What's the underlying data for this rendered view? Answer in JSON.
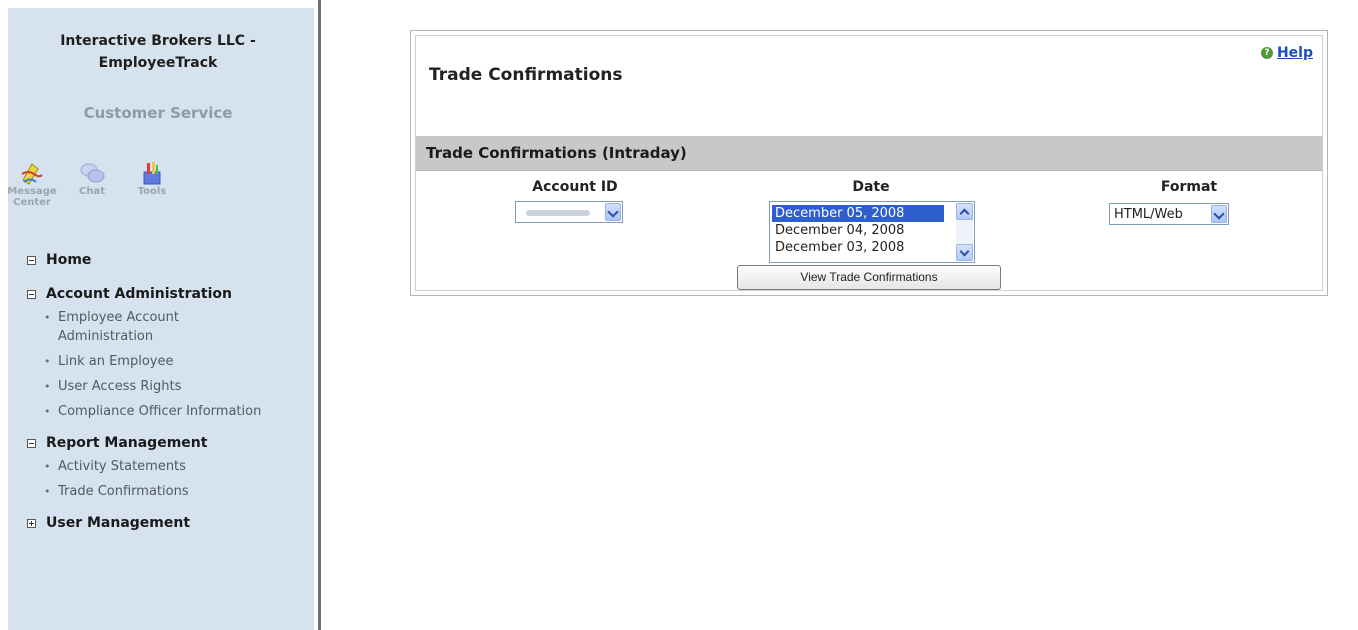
{
  "sidebar": {
    "brand_line1": "Interactive Brokers LLC -",
    "brand_line2": "EmployeeTrack",
    "section_title": "Customer Service",
    "quick_links": [
      {
        "label_line1": "Message",
        "label_line2": "Center",
        "icon": "message-center-icon"
      },
      {
        "label_line1": "Chat",
        "label_line2": "",
        "icon": "chat-icon"
      },
      {
        "label_line1": "Tools",
        "label_line2": "",
        "icon": "tools-icon"
      }
    ],
    "nav": {
      "home": {
        "label": "Home",
        "state": "expanded"
      },
      "account_admin": {
        "label": "Account Administration",
        "state": "expanded",
        "items": [
          "Employee Account Administration",
          "Link an Employee",
          "User Access Rights",
          "Compliance Officer Information"
        ]
      },
      "report_mgmt": {
        "label": "Report Management",
        "state": "expanded",
        "items": [
          "Activity Statements",
          "Trade Confirmations"
        ]
      },
      "user_mgmt": {
        "label": "User Management",
        "state": "collapsed"
      }
    }
  },
  "main": {
    "title": "Trade Confirmations",
    "help_label": "Help",
    "subheader": "Trade Confirmations (Intraday)",
    "columns": {
      "account": "Account ID",
      "date": "Date",
      "format": "Format"
    },
    "date_options": [
      "December 05, 2008",
      "December 04, 2008",
      "December 03, 2008"
    ],
    "date_selected_index": 0,
    "format_value": "HTML/Web",
    "view_button": "View Trade Confirmations"
  },
  "colors": {
    "sidebar_bg": "#d6e3ef",
    "subheader_bg": "#c8c8c8",
    "link": "#1d4fb8",
    "selection": "#2f5fce"
  }
}
